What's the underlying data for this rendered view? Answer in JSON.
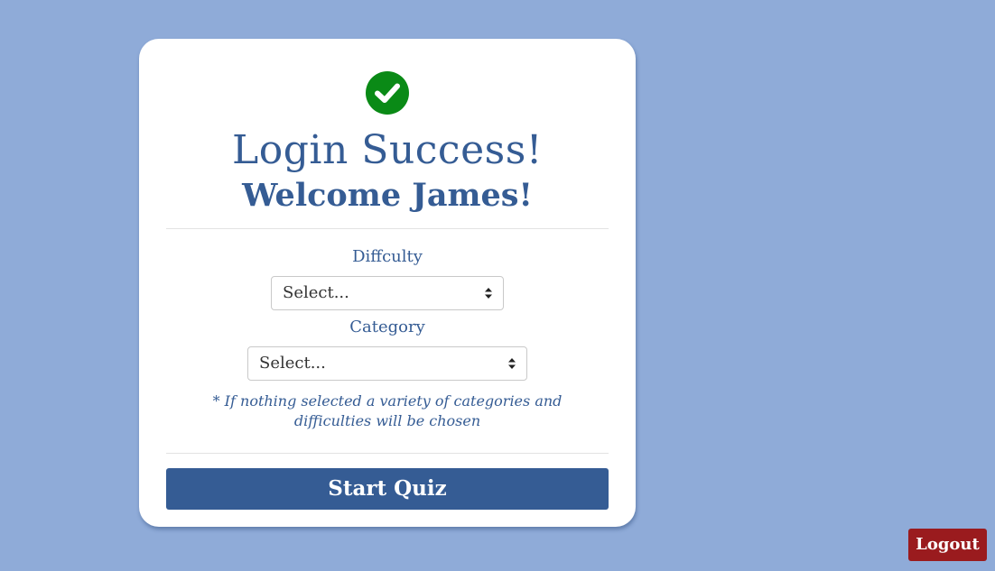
{
  "colors": {
    "background": "#8fabd8",
    "primary": "#355c94",
    "success": "#0a8a16",
    "danger": "#9a1b1e"
  },
  "card": {
    "status_icon": "check-circle-icon",
    "title": "Login Success!",
    "welcome": "Welcome James!"
  },
  "form": {
    "difficulty": {
      "label": "Diffculty",
      "selected": "Select...",
      "arrow_icon": "sort-arrows-icon"
    },
    "category": {
      "label": "Category",
      "selected": "Select...",
      "arrow_icon": "sort-arrows-icon"
    },
    "note": "* If nothing selected a variety of categories and difficulties will be chosen"
  },
  "actions": {
    "start_label": "Start Quiz",
    "logout_label": "Logout"
  }
}
